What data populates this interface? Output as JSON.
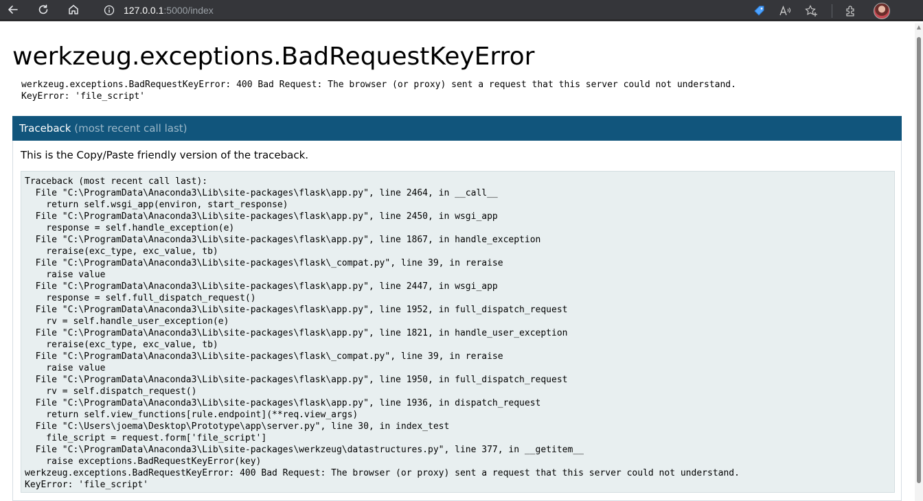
{
  "browser": {
    "url_host": "127.0.0.1",
    "url_rest": ":5000/index",
    "icons": [
      "back-arrow-icon",
      "reload-icon",
      "home-icon",
      "site-info-icon",
      "coupon-tag-icon",
      "read-aloud-icon",
      "add-favorite-icon",
      "extensions-icon",
      "profile-avatar"
    ]
  },
  "page": {
    "title": "werkzeug.exceptions.BadRequestKeyError",
    "error_line1": "werkzeug.exceptions.BadRequestKeyError: 400 Bad Request: The browser (or proxy) sent a request that this server could not understand.",
    "error_line2": "KeyError: 'file_script'",
    "traceback_title": "Traceback",
    "traceback_subtitle": "(most recent call last)",
    "explanation": "This is the Copy/Paste friendly version of the traceback.",
    "traceback_lines": [
      "Traceback (most recent call last):",
      "  File \"C:\\ProgramData\\Anaconda3\\Lib\\site-packages\\flask\\app.py\", line 2464, in __call__",
      "    return self.wsgi_app(environ, start_response)",
      "  File \"C:\\ProgramData\\Anaconda3\\Lib\\site-packages\\flask\\app.py\", line 2450, in wsgi_app",
      "    response = self.handle_exception(e)",
      "  File \"C:\\ProgramData\\Anaconda3\\Lib\\site-packages\\flask\\app.py\", line 1867, in handle_exception",
      "    reraise(exc_type, exc_value, tb)",
      "  File \"C:\\ProgramData\\Anaconda3\\Lib\\site-packages\\flask\\_compat.py\", line 39, in reraise",
      "    raise value",
      "  File \"C:\\ProgramData\\Anaconda3\\Lib\\site-packages\\flask\\app.py\", line 2447, in wsgi_app",
      "    response = self.full_dispatch_request()",
      "  File \"C:\\ProgramData\\Anaconda3\\Lib\\site-packages\\flask\\app.py\", line 1952, in full_dispatch_request",
      "    rv = self.handle_user_exception(e)",
      "  File \"C:\\ProgramData\\Anaconda3\\Lib\\site-packages\\flask\\app.py\", line 1821, in handle_user_exception",
      "    reraise(exc_type, exc_value, tb)",
      "  File \"C:\\ProgramData\\Anaconda3\\Lib\\site-packages\\flask\\_compat.py\", line 39, in reraise",
      "    raise value",
      "  File \"C:\\ProgramData\\Anaconda3\\Lib\\site-packages\\flask\\app.py\", line 1950, in full_dispatch_request",
      "    rv = self.dispatch_request()",
      "  File \"C:\\ProgramData\\Anaconda3\\Lib\\site-packages\\flask\\app.py\", line 1936, in dispatch_request",
      "    return self.view_functions[rule.endpoint](**req.view_args)",
      "  File \"C:\\Users\\joema\\Desktop\\Prototype\\app\\server.py\", line 30, in index_test",
      "    file_script = request.form['file_script']",
      "  File \"C:\\ProgramData\\Anaconda3\\Lib\\site-packages\\werkzeug\\datastructures.py\", line 377, in __getitem__",
      "    raise exceptions.BadRequestKeyError(key)",
      "werkzeug.exceptions.BadRequestKeyError: 400 Bad Request: The browser (or proxy) sent a request that this server could not understand.",
      "KeyError: 'file_script'"
    ]
  },
  "colors": {
    "chrome_bg": "#35363a",
    "traceback_header": "#11557c",
    "plain_bg": "#e8eff0"
  }
}
